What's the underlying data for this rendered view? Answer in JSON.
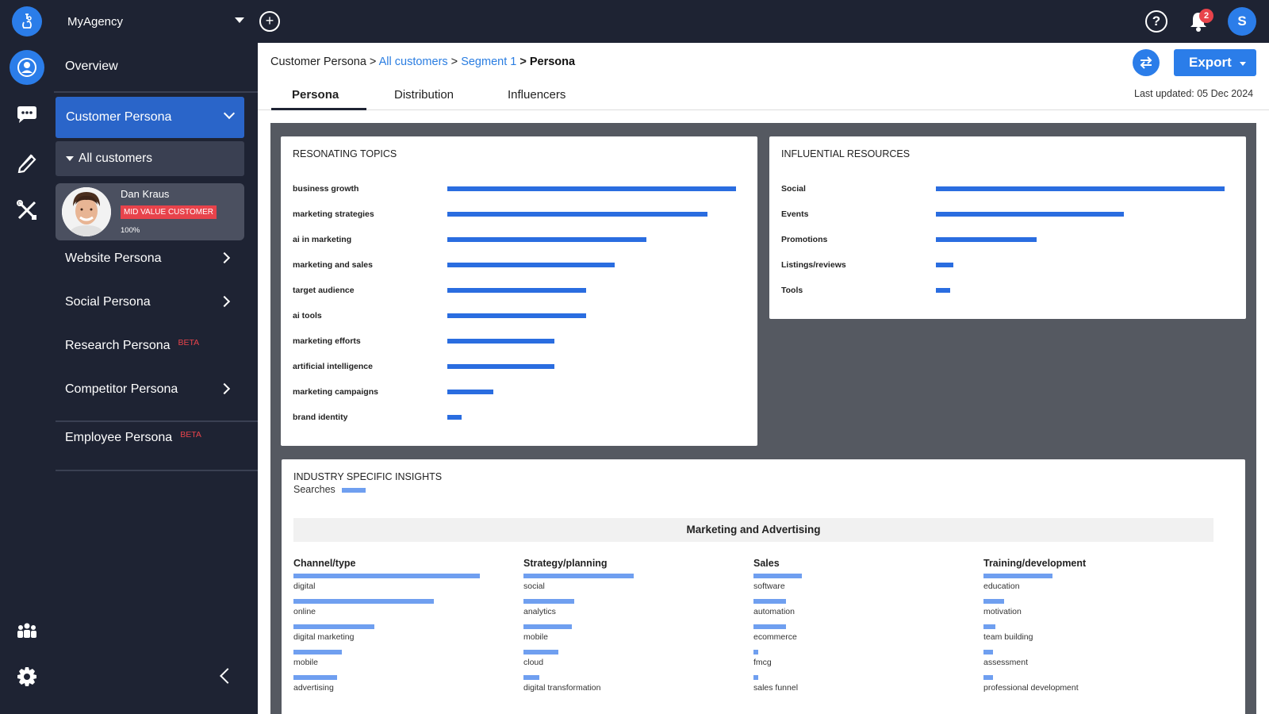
{
  "app": {
    "agency_name": "MyAgency",
    "user_initial": "S",
    "notification_count": "2",
    "help_icon_text": "?"
  },
  "sidebar": {
    "overview": "Overview",
    "customer_persona": "Customer Persona",
    "all_customers": "All customers",
    "persona_card": {
      "name": "Dan Kraus",
      "badge": "MID VALUE CUSTOMER",
      "percent": "100%"
    },
    "website_persona": "Website Persona",
    "social_persona": "Social Persona",
    "research_persona": "Research Persona",
    "research_beta": "BETA",
    "competitor_persona": "Competitor Persona",
    "employee_persona": "Employee Persona",
    "employee_beta": "BETA"
  },
  "breadcrumb": {
    "root": "Customer Persona",
    "sep": " > ",
    "all": "All customers",
    "segment": "Segment 1",
    "current": "Persona"
  },
  "header": {
    "export_label": "Export",
    "last_updated": "Last updated: 05 Dec 2024"
  },
  "tabs": {
    "persona": "Persona",
    "distribution": "Distribution",
    "influencers": "Influencers"
  },
  "colors": {
    "accent": "#2b7de9",
    "bar": "#2a6de0",
    "bar_light": "#6f9ff0",
    "badge": "#e8434b",
    "dark_bg": "#1e2333"
  },
  "resonating_topics": {
    "title": "RESONATING TOPICS",
    "items": [
      {
        "label": "business growth",
        "value": 1.0
      },
      {
        "label": "marketing strategies",
        "value": 0.9
      },
      {
        "label": "ai in marketing",
        "value": 0.69
      },
      {
        "label": "marketing and sales",
        "value": 0.58
      },
      {
        "label": "target audience",
        "value": 0.48
      },
      {
        "label": "ai tools",
        "value": 0.48
      },
      {
        "label": "marketing efforts",
        "value": 0.37
      },
      {
        "label": "artificial intelligence",
        "value": 0.37
      },
      {
        "label": "marketing campaigns",
        "value": 0.16
      },
      {
        "label": "brand identity",
        "value": 0.05
      }
    ]
  },
  "influential_resources": {
    "title": "INFLUENTIAL RESOURCES",
    "items": [
      {
        "label": "Social",
        "value": 1.0
      },
      {
        "label": "Events",
        "value": 0.65
      },
      {
        "label": "Promotions",
        "value": 0.35
      },
      {
        "label": "Listings/reviews",
        "value": 0.06
      },
      {
        "label": "Tools",
        "value": 0.05
      }
    ]
  },
  "industry_insights": {
    "title": "INDUSTRY SPECIFIC INSIGHTS",
    "legend": "Searches",
    "header": "Marketing and Advertising",
    "columns": [
      {
        "title": "Channel/type",
        "items": [
          {
            "label": "digital",
            "value": 0.81
          },
          {
            "label": "online",
            "value": 0.61
          },
          {
            "label": "digital marketing",
            "value": 0.35
          },
          {
            "label": "mobile",
            "value": 0.21
          },
          {
            "label": "advertising",
            "value": 0.19
          }
        ]
      },
      {
        "title": "Strategy/planning",
        "items": [
          {
            "label": "social",
            "value": 0.48
          },
          {
            "label": "analytics",
            "value": 0.22
          },
          {
            "label": "mobile",
            "value": 0.21
          },
          {
            "label": "cloud",
            "value": 0.15
          },
          {
            "label": "digital transformation",
            "value": 0.07
          }
        ]
      },
      {
        "title": "Sales",
        "items": [
          {
            "label": "software",
            "value": 0.21
          },
          {
            "label": "automation",
            "value": 0.14
          },
          {
            "label": "ecommerce",
            "value": 0.14
          },
          {
            "label": "fmcg",
            "value": 0.02
          },
          {
            "label": "sales funnel",
            "value": 0.02
          }
        ]
      },
      {
        "title": "Training/development",
        "items": [
          {
            "label": "education",
            "value": 0.3
          },
          {
            "label": "motivation",
            "value": 0.09
          },
          {
            "label": "team building",
            "value": 0.05
          },
          {
            "label": "assessment",
            "value": 0.04
          },
          {
            "label": "professional development",
            "value": 0.04
          }
        ]
      }
    ]
  }
}
